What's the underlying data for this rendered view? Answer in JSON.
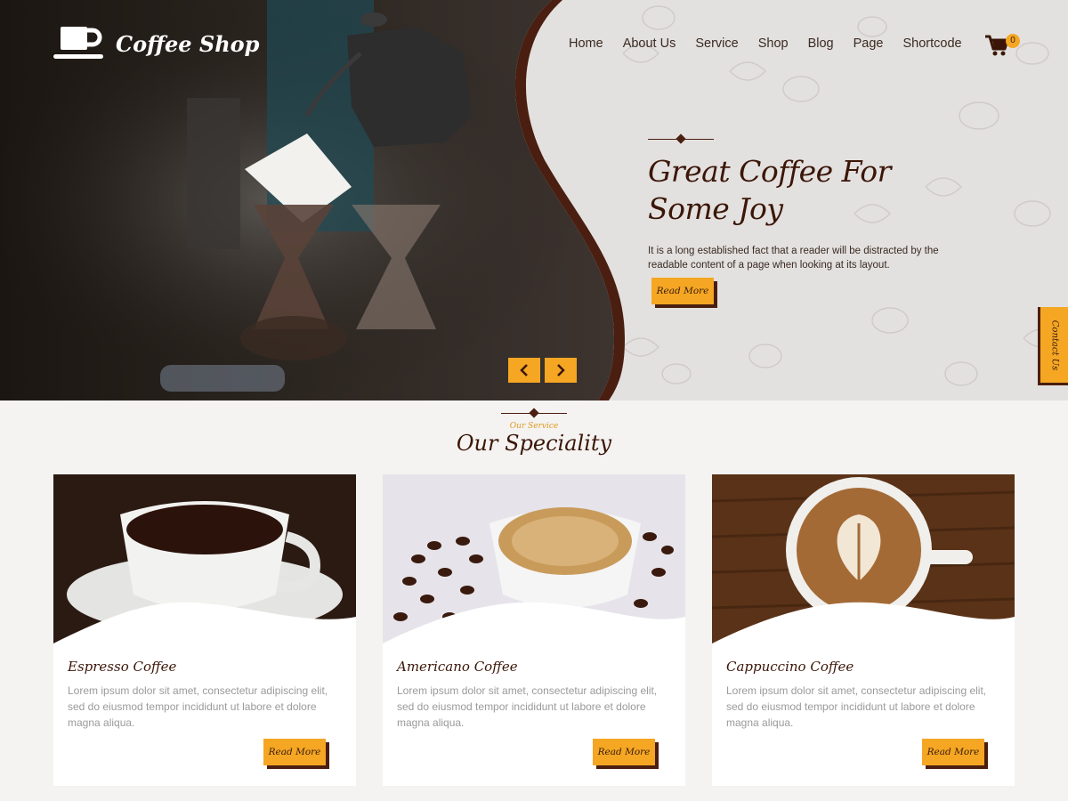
{
  "brand": {
    "name": "Coffee Shop",
    "logo_icon": "coffee-cup-icon"
  },
  "nav": {
    "items": [
      "Home",
      "About Us",
      "Service",
      "Shop",
      "Blog",
      "Page",
      "Shortcode"
    ],
    "cart_count": "0",
    "cart_icon": "cart-icon"
  },
  "hero": {
    "title_line1": "Great Coffee For",
    "title_line2": "Some Joy",
    "description": "It  is  a long established fact that a reader will be distracted  by  the readable content  of  a  page when looking at  its layout.",
    "button_label": "Read More",
    "prev_icon": "chevron-left-icon",
    "next_icon": "chevron-right-icon"
  },
  "contact_tab": {
    "label": "Contact Us"
  },
  "speciality": {
    "subtitle": "Our Service",
    "title": "Our Speciality",
    "cards": [
      {
        "name": "Espresso Coffee",
        "description": "Lorem ipsum dolor sit amet, consectetur adipiscing elit, sed do eiusmod tempor incididunt ut labore et dolore magna aliqua.",
        "button_label": "Read More"
      },
      {
        "name": "Americano Coffee",
        "description": "Lorem ipsum dolor sit amet, consectetur adipiscing elit, sed do eiusmod tempor incididunt ut labore et dolore magna aliqua.",
        "button_label": "Read More"
      },
      {
        "name": "Cappuccino Coffee",
        "description": "Lorem ipsum dolor sit amet, consectetur adipiscing elit, sed do eiusmod tempor incididunt ut labore et dolore magna aliqua.",
        "button_label": "Read More"
      }
    ]
  },
  "colors": {
    "accent": "#f5a623",
    "dark_brown": "#4a1e10",
    "heading": "#3b1608",
    "text_muted": "#9a9a9a"
  }
}
